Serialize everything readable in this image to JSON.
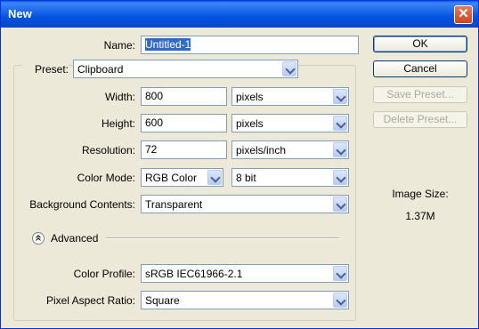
{
  "window": {
    "title": "New"
  },
  "name": {
    "label": "Name:",
    "value": "Untitled-1"
  },
  "preset": {
    "label": "Preset:",
    "value": "Clipboard"
  },
  "width": {
    "label": "Width:",
    "value": "800",
    "unit": "pixels"
  },
  "height": {
    "label": "Height:",
    "value": "600",
    "unit": "pixels"
  },
  "resolution": {
    "label": "Resolution:",
    "value": "72",
    "unit": "pixels/inch"
  },
  "color_mode": {
    "label": "Color Mode:",
    "value": "RGB Color",
    "depth": "8 bit"
  },
  "background": {
    "label": "Background Contents:",
    "value": "Transparent"
  },
  "advanced": {
    "label": "Advanced"
  },
  "color_profile": {
    "label": "Color Profile:",
    "value": "sRGB IEC61966-2.1"
  },
  "pixel_aspect": {
    "label": "Pixel Aspect Ratio:",
    "value": "Square"
  },
  "buttons": {
    "ok": "OK",
    "cancel": "Cancel",
    "save_preset": "Save Preset...",
    "delete_preset": "Delete Preset..."
  },
  "image_size": {
    "label": "Image Size:",
    "value": "1.37M"
  },
  "icons": {
    "close": "close-icon",
    "advanced_toggle": "collapse-chevron-icon",
    "dropdown": "chevron-down-icon"
  }
}
